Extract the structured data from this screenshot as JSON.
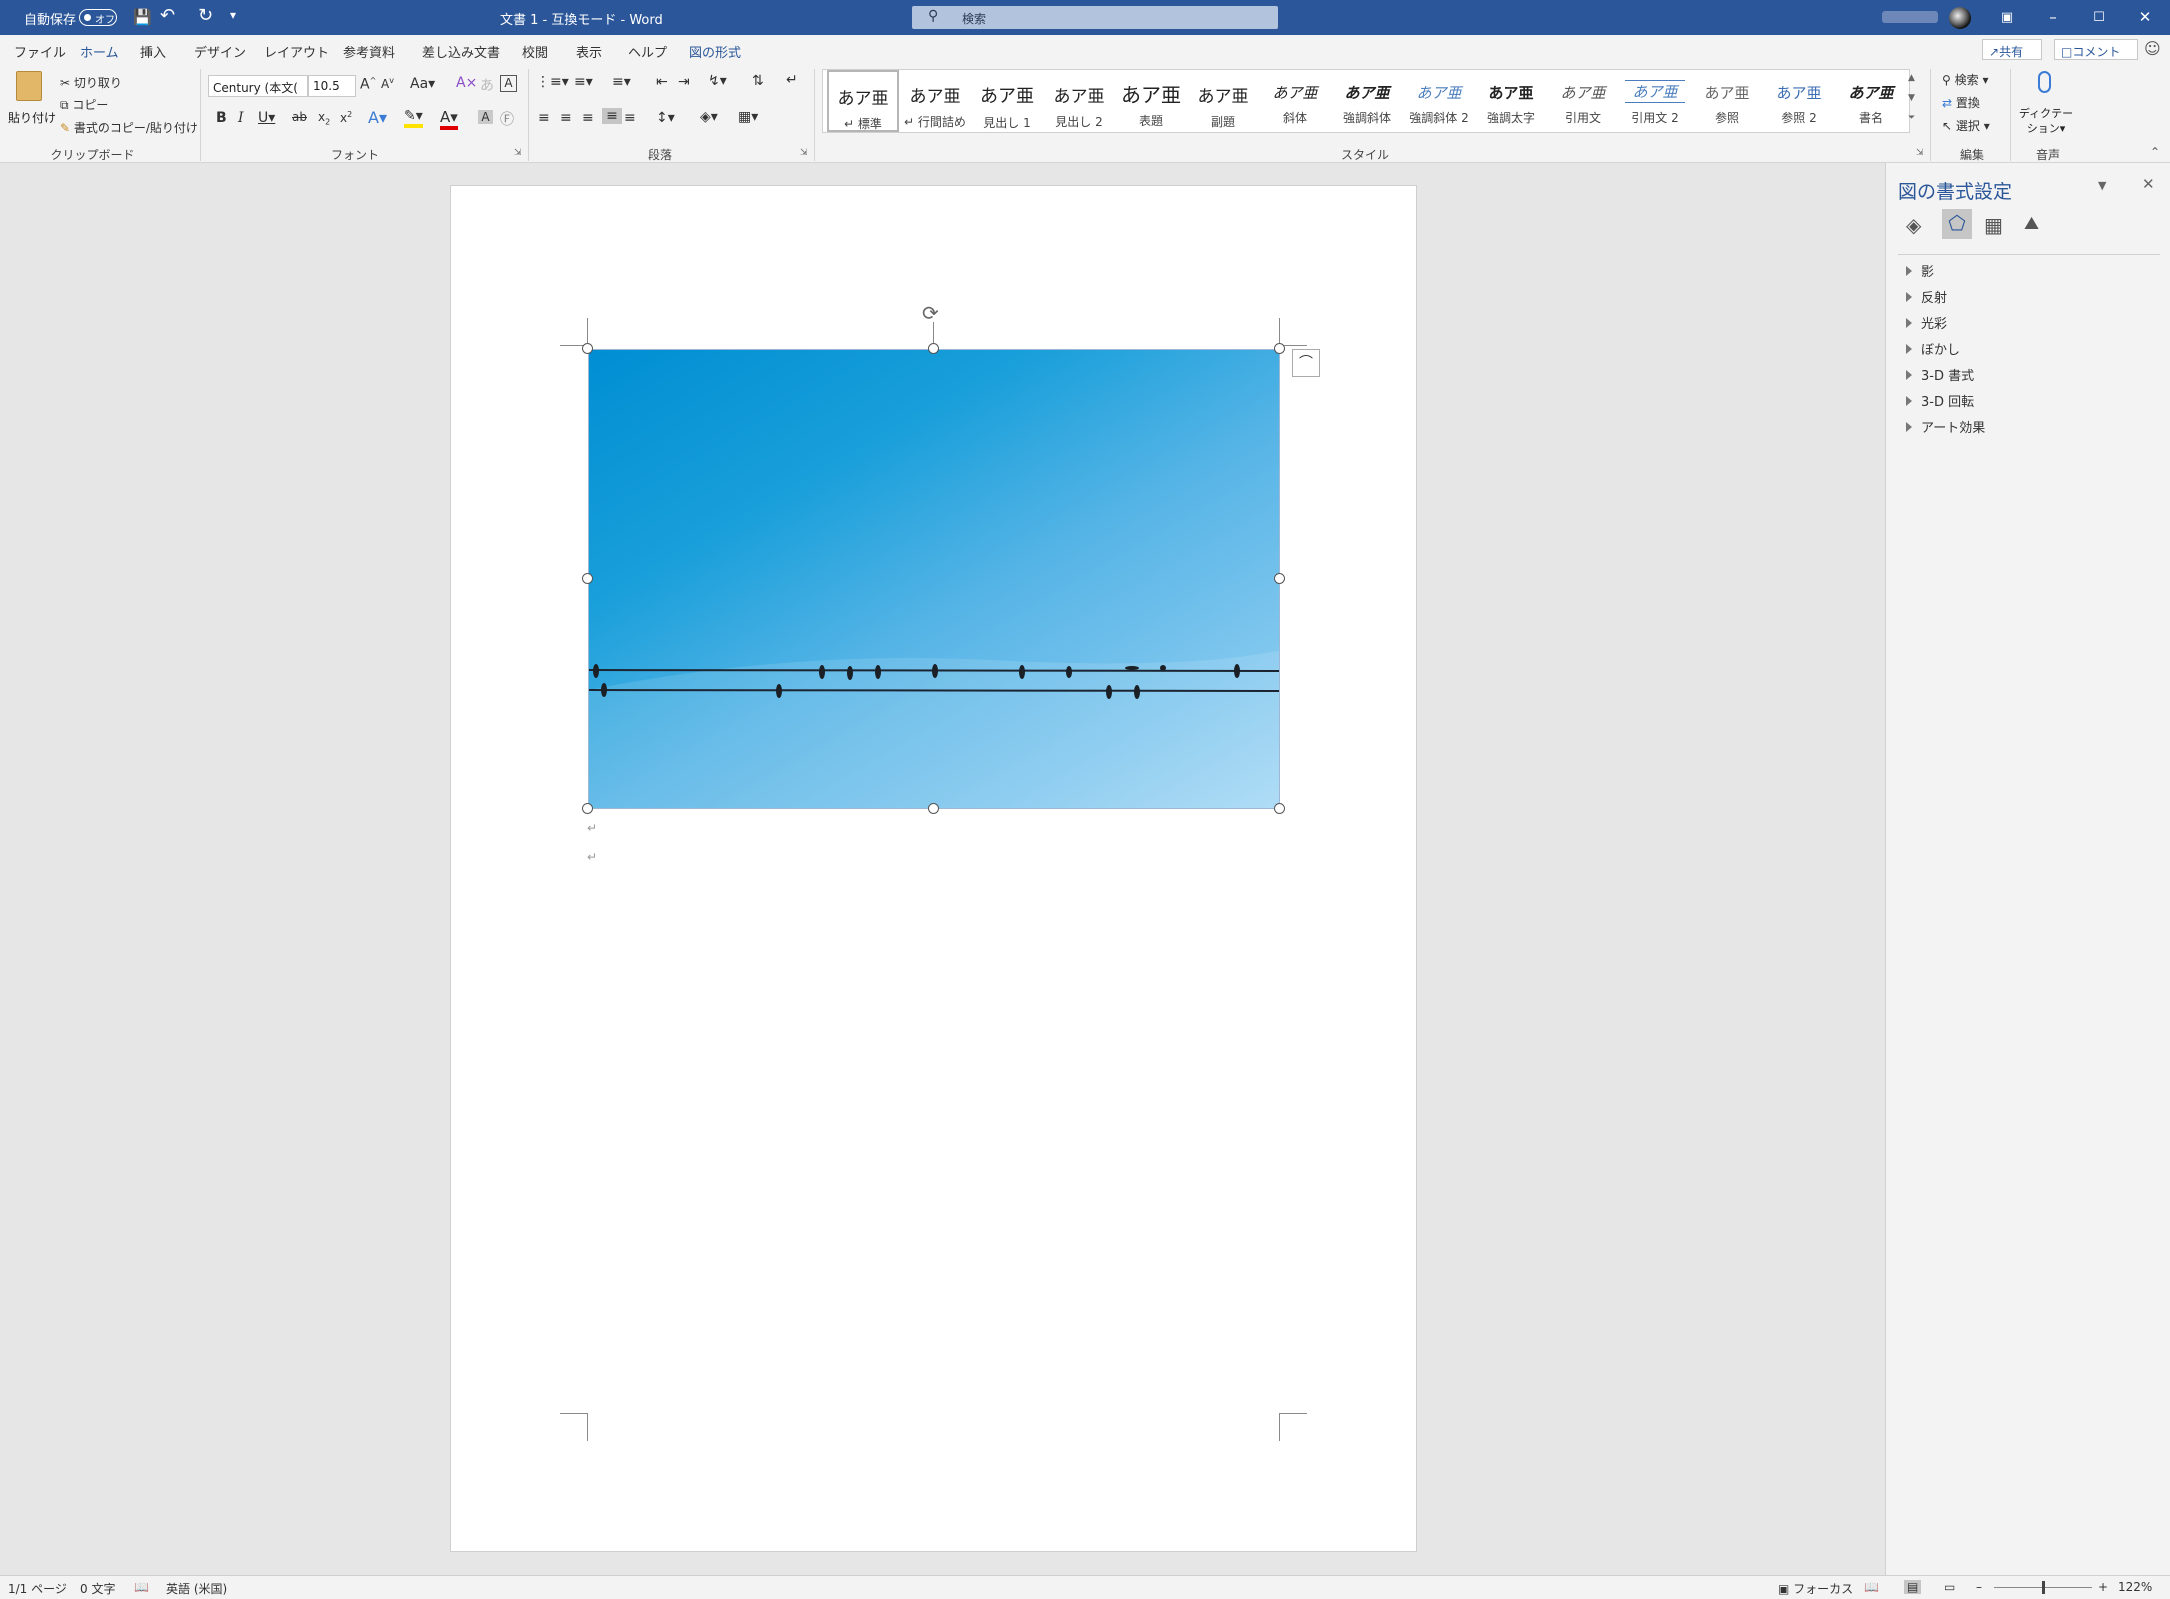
{
  "titlebar": {
    "autosave_label": "自動保存",
    "autosave_state": "オフ",
    "doc_title": "文書 1  -  互換モード  -  Word",
    "search_placeholder": "検索",
    "bg_color": "#2b579a"
  },
  "menubar": {
    "tabs": [
      "ファイル",
      "ホーム",
      "挿入",
      "デザイン",
      "レイアウト",
      "参考資料",
      "差し込み文書",
      "校閲",
      "表示",
      "ヘルプ",
      "図の形式"
    ],
    "active_tab": "ホーム",
    "share_label": "共有",
    "comment_label": "コメント"
  },
  "ribbon": {
    "clipboard": {
      "paste": "貼り付け",
      "cut": "切り取り",
      "copy": "コピー",
      "format_painter": "書式のコピー/貼り付け",
      "group": "クリップボード"
    },
    "font": {
      "name": "Century (本文(",
      "size": "10.5",
      "group": "フォント"
    },
    "paragraph": {
      "group": "段落"
    },
    "styles": {
      "items": [
        "標準",
        "行間詰め",
        "見出し 1",
        "見出し 2",
        "表題",
        "副題",
        "斜体",
        "強調斜体",
        "強調斜体 2",
        "強調太字",
        "引用文",
        "引用文 2",
        "参照",
        "参照 2",
        "書名"
      ],
      "sample": "あア亜",
      "group": "スタイル"
    },
    "editing": {
      "find": "検索",
      "replace": "置換",
      "select": "選択",
      "group": "編集"
    },
    "voice": {
      "dictate_1": "ディクテー",
      "dictate_2": "ション",
      "group": "音声"
    }
  },
  "pane": {
    "title": "図の書式設定",
    "items": [
      "影",
      "反射",
      "光彩",
      "ぼかし",
      "3-D 書式",
      "3-D 回転",
      "アート効果"
    ],
    "tab_icons": [
      "fill-line-icon",
      "effects-icon",
      "layout-size-icon",
      "picture-icon"
    ]
  },
  "status": {
    "page": "1/1 ページ",
    "words": "0 文字",
    "language": "英語 (米国)",
    "focus": "フォーカス",
    "zoom": "122%"
  }
}
